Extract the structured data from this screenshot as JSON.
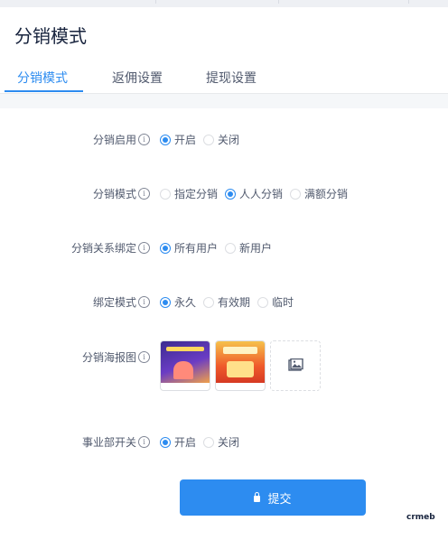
{
  "page": {
    "title": "分销模式"
  },
  "tabs": [
    {
      "label": "分销模式",
      "active": true
    },
    {
      "label": "返佣设置",
      "active": false
    },
    {
      "label": "提现设置",
      "active": false
    }
  ],
  "form": {
    "enable": {
      "label": "分销启用",
      "options": [
        "开启",
        "关闭"
      ],
      "selected": "开启"
    },
    "mode": {
      "label": "分销模式",
      "options": [
        "指定分销",
        "人人分销",
        "满额分销"
      ],
      "selected": "人人分销"
    },
    "binding": {
      "label": "分销关系绑定",
      "options": [
        "所有用户",
        "新用户"
      ],
      "selected": "所有用户"
    },
    "bind_mode": {
      "label": "绑定模式",
      "options": [
        "永久",
        "有效期",
        "临时"
      ],
      "selected": "永久"
    },
    "poster": {
      "label": "分销海报图"
    },
    "division": {
      "label": "事业部开关",
      "options": [
        "开启",
        "关闭"
      ],
      "selected": "开启"
    },
    "info_glyph": "i"
  },
  "submit": {
    "label": "提交"
  },
  "brand": {
    "text": "crmeb"
  },
  "colors": {
    "accent": "#2d8cf0",
    "border": "#dcdee2",
    "text": "#515a6e",
    "title": "#17233d"
  },
  "icons": {
    "info": "info-circle-icon",
    "upload": "image-upload-icon",
    "submit": "lock-icon"
  }
}
